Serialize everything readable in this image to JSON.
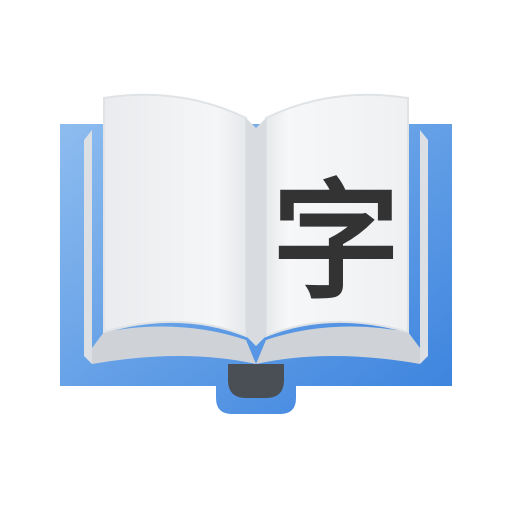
{
  "icon": {
    "name": "dictionary-book-icon",
    "glyph": "字",
    "colors": {
      "cover_light": "#7fb2ec",
      "cover_dark": "#3d86e0",
      "cover_edge": "#2f74cc",
      "page_left": "#f1f2f4",
      "page_right": "#f4f5f6",
      "page_shadow": "#cfd3d8",
      "page_edge": "#e3e6e9",
      "spine_knob": "#4a4f55",
      "glyph": "#333333"
    }
  }
}
